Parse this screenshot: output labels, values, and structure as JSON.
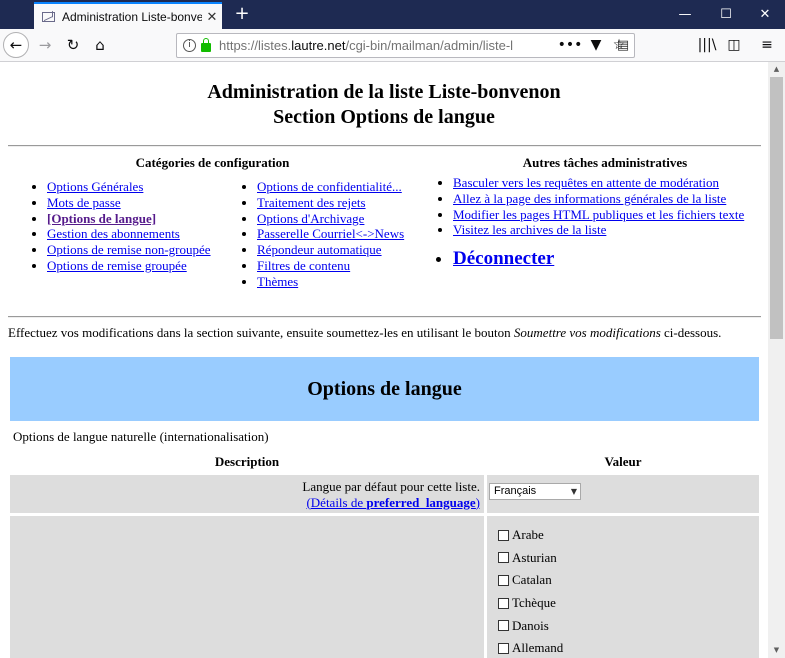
{
  "browser": {
    "tab_title": "Administration Liste-bonvenon",
    "url_prefix": "https://listes.",
    "url_host": "lautre.net",
    "url_path": "/cgi-bin/mailman/admin/liste-l",
    "new_tab": "+",
    "win_minimize": "—",
    "win_maximize": "☐",
    "win_close": "✕",
    "icons": [
      "back-icon",
      "forward-icon",
      "reload-icon",
      "home-icon",
      "info-icon",
      "lock-icon",
      "reader-icon",
      "more-icon",
      "pocket-icon",
      "star-icon",
      "library-icon",
      "sidebar-icon",
      "menu-icon"
    ]
  },
  "page": {
    "title_line1": "Administration de la liste Liste-bonvenon",
    "title_line2": "Section Options de langue",
    "config_heading": "Catégories de configuration",
    "tasks_heading": "Autres tâches administratives",
    "config_col1": [
      {
        "label": "Options Générales",
        "current": false
      },
      {
        "label": "Mots de passe",
        "current": false
      },
      {
        "label": "[Options de langue]",
        "current": true
      },
      {
        "label": "Gestion des abonnements",
        "current": false
      },
      {
        "label": "Options de remise non-groupée",
        "current": false
      },
      {
        "label": "Options de remise groupée",
        "current": false
      }
    ],
    "config_col2": [
      {
        "label": "Options de confidentialité..."
      },
      {
        "label": "Traitement des rejets"
      },
      {
        "label": "Options d'Archivage"
      },
      {
        "label": "Passerelle Courriel<->News"
      },
      {
        "label": "Répondeur automatique"
      },
      {
        "label": "Filtres de contenu"
      },
      {
        "label": "Thèmes"
      }
    ],
    "tasks": [
      {
        "label": "Basculer vers les requêtes en attente de modération"
      },
      {
        "label": "Allez à la page des informations générales de la liste"
      },
      {
        "label": "Modifier les pages HTML publiques et les fichiers texte"
      },
      {
        "label": "Visitez les archives de la liste"
      }
    ],
    "logout": "Déconnecter",
    "intro_before": "Effectuez vos modifications dans la section suivante, ensuite soumettez-les en utilisant le bouton ",
    "intro_em": "Soumettre vos modifications",
    "intro_after": " ci-dessous.",
    "section_title": "Options de langue",
    "section_desc": "Options de langue naturelle (internationalisation)",
    "col_description": "Description",
    "col_value": "Valeur",
    "row1_label": "Langue par défaut pour cette liste.",
    "row1_link_prefix": "(Détails de ",
    "row1_link_bold": "preferred_language",
    "row1_link_suffix": ")",
    "row1_select": "Français",
    "languages": [
      {
        "label": "Arabe",
        "checked": false
      },
      {
        "label": "Asturian",
        "checked": false
      },
      {
        "label": "Catalan",
        "checked": false
      },
      {
        "label": "Tchèque",
        "checked": false
      },
      {
        "label": "Danois",
        "checked": false
      },
      {
        "label": "Allemand",
        "checked": false
      }
    ]
  },
  "colors": {
    "link": "#0000ee",
    "visited_link": "#551a8b",
    "section_band": "#99ccff",
    "table_cell": "#dddddd",
    "tabbar": "#1e2a52"
  }
}
